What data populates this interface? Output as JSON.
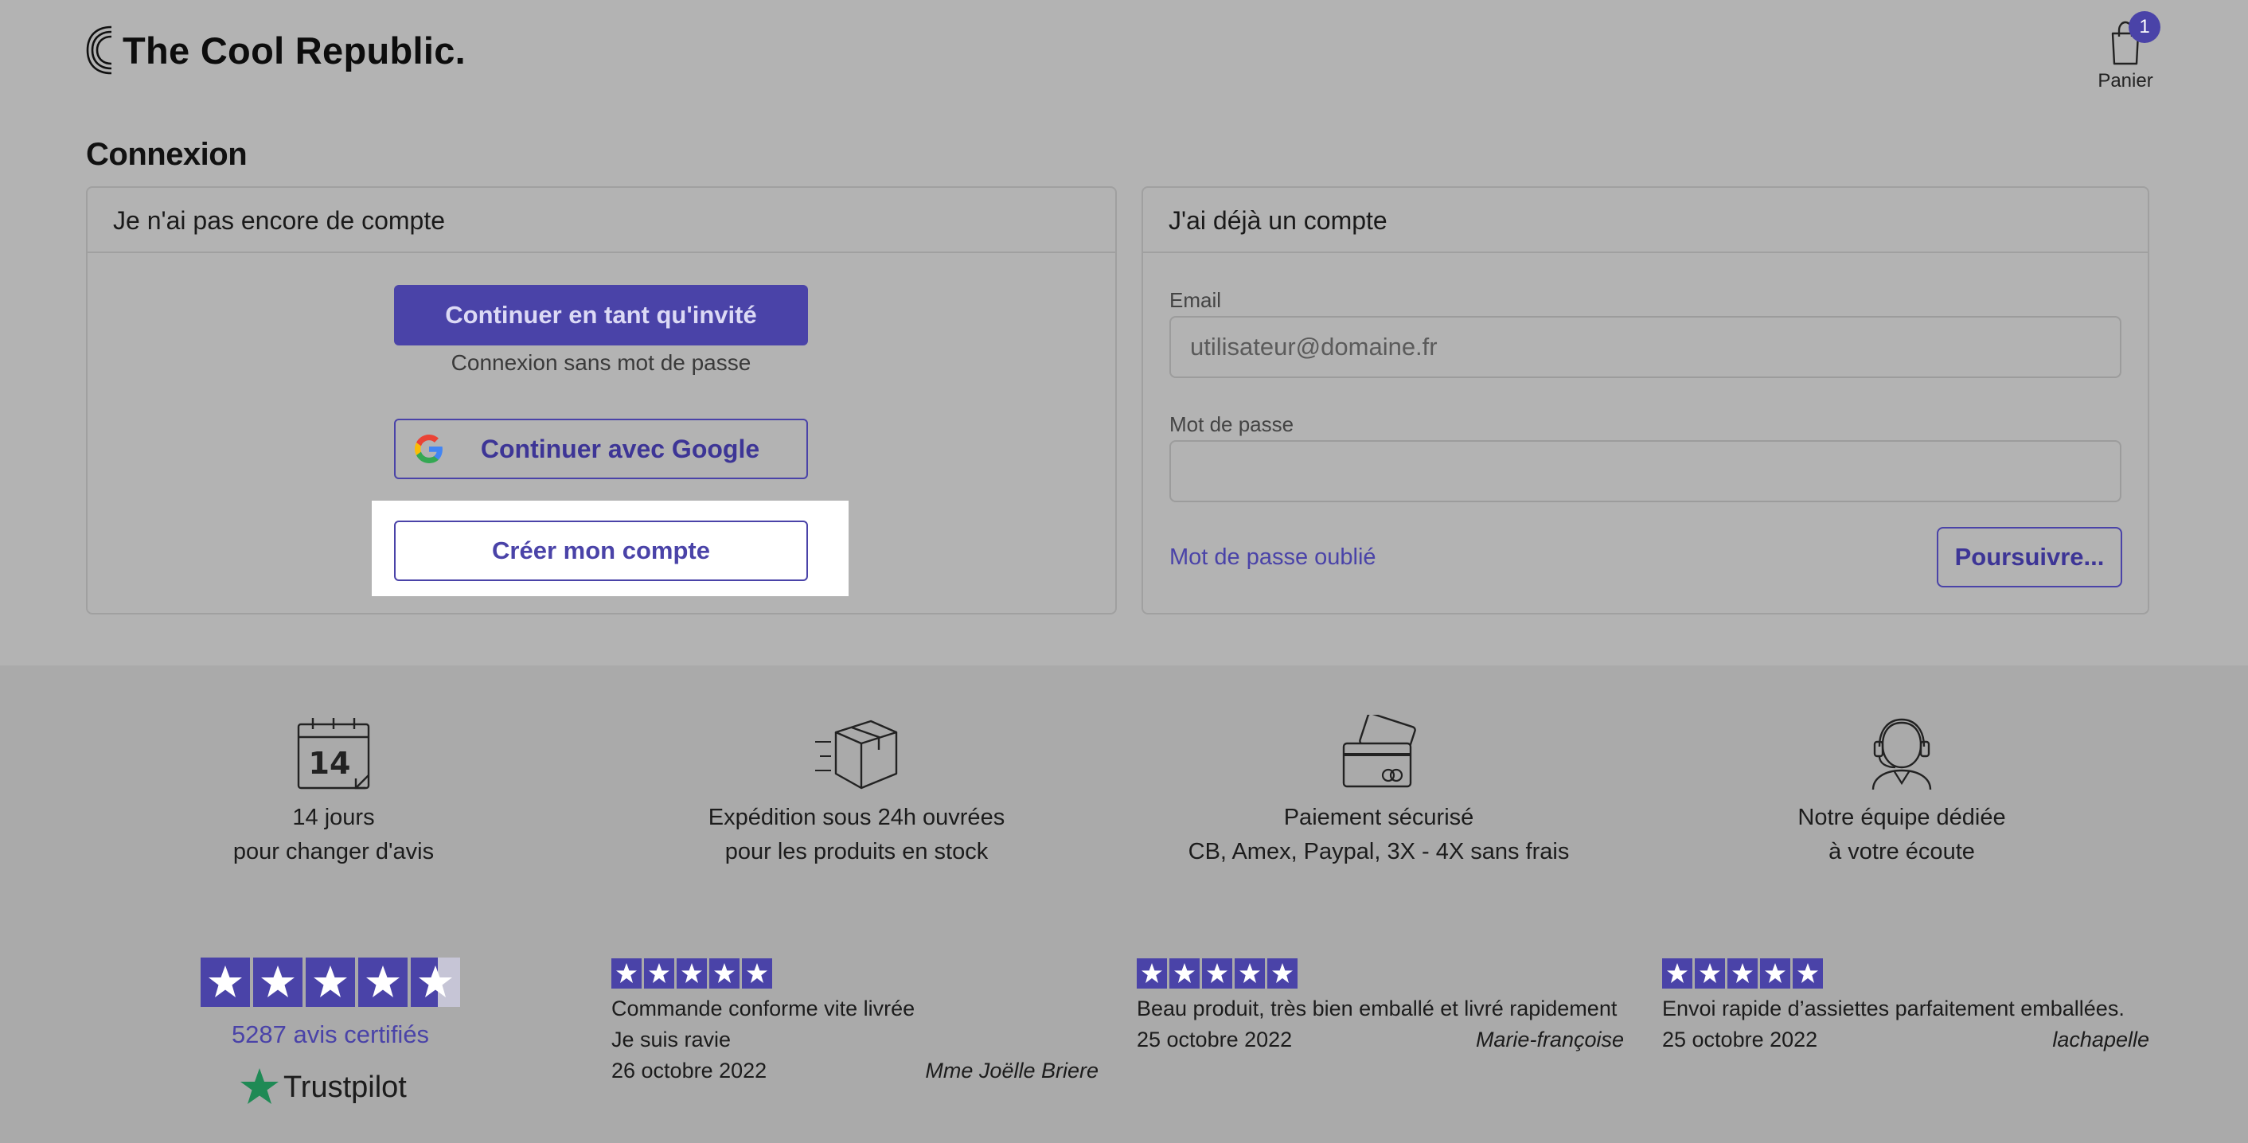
{
  "header": {
    "brand": "The Cool Republic.",
    "cart_count": "1",
    "cart_label": "Panier"
  },
  "page_title": "Connexion",
  "no_account": {
    "heading": "Je n'ai pas encore de compte",
    "guest_button": "Continuer en tant qu'invité",
    "guest_subtitle": "Connexion sans mot de passe",
    "google_button": "Continuer avec Google",
    "create_button": "Créer mon compte"
  },
  "has_account": {
    "heading": "J'ai déjà un compte",
    "email_label": "Email",
    "email_placeholder": "utilisateur@domaine.fr",
    "password_label": "Mot de passe",
    "forgot_link": "Mot de passe oublié",
    "submit_button": "Poursuivre..."
  },
  "features": [
    {
      "icon": "calendar-icon",
      "line1": "14 jours",
      "line2": "pour changer d'avis",
      "calendar_number": "14"
    },
    {
      "icon": "box-icon",
      "line1": "Expédition sous 24h ouvrées",
      "line2": "pour les produits en stock"
    },
    {
      "icon": "credit-card-icon",
      "line1": "Paiement sécurisé",
      "line2": "CB, Amex, Paypal, 3X - 4X sans frais"
    },
    {
      "icon": "headset-icon",
      "line1": "Notre équipe dédiée",
      "line2": "à votre écoute"
    }
  ],
  "trustpilot": {
    "rating": 4.5,
    "reviews_count": "5287 avis certifiés",
    "brand": "Trustpilot"
  },
  "reviews": [
    {
      "stars": 5,
      "title": "Commande conforme vite livrée",
      "body": "Je suis ravie",
      "date": "26 octobre 2022",
      "author": "Mme Joëlle Briere"
    },
    {
      "stars": 5,
      "title": "Beau produit, très bien emballé et livré rapidement",
      "body": "",
      "date": "25 octobre 2022",
      "author": "Marie-françoise"
    },
    {
      "stars": 5,
      "title": "Envoi rapide d’assiettes parfaitement emballées.",
      "body": "",
      "date": "25 octobre 2022",
      "author": "lachapelle"
    }
  ],
  "colors": {
    "accent": "#4a43a8",
    "overlay_background": "#b3b3b3",
    "footer_background": "#aaaaaa",
    "highlight": "#ffffff"
  }
}
